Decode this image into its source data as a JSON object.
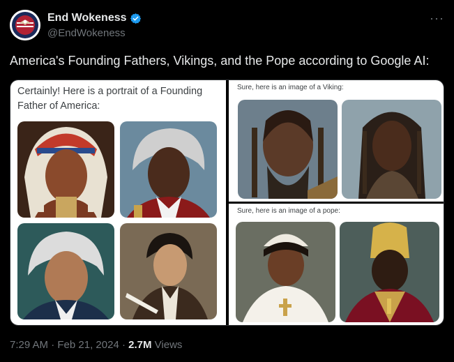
{
  "author": {
    "display_name": "End Wokeness",
    "handle": "@EndWokeness",
    "verified": true,
    "avatar_icon": "eagle-flag-badge-icon"
  },
  "tweet": {
    "text": "America's Founding Fathers, Vikings, and the Pope according to Google AI:"
  },
  "media": {
    "founding_father_caption": "Certainly! Here is a portrait of a Founding Father of America:",
    "viking_caption": "Sure, here is an image of a Viking:",
    "pope_caption": "Sure, here is an image of a pope:"
  },
  "footer": {
    "time": "7:29 AM",
    "separator": "·",
    "date": "Feb 21, 2024",
    "views_count": "2.7M",
    "views_label": "Views"
  },
  "colors": {
    "background": "#000000",
    "text_primary": "#e7e9ea",
    "text_secondary": "#71767b",
    "verified_blue": "#1d9bf0"
  }
}
